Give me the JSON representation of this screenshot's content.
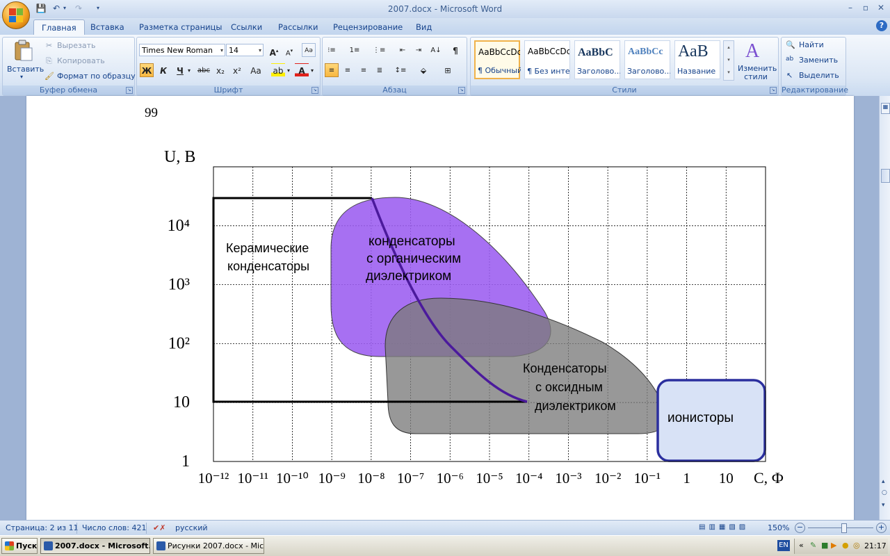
{
  "window": {
    "title": "2007.docx - Microsoft Word",
    "controls": [
      "–",
      "▫",
      "✕"
    ],
    "help": "?"
  },
  "quick_access": [
    "💾",
    "↶",
    "▾",
    "↷",
    "▾"
  ],
  "tabs": [
    {
      "label": "Главная",
      "active": true
    },
    {
      "label": "Вставка",
      "active": false
    },
    {
      "label": "Разметка страницы",
      "active": false
    },
    {
      "label": "Ссылки",
      "active": false
    },
    {
      "label": "Рассылки",
      "active": false
    },
    {
      "label": "Рецензирование",
      "active": false
    },
    {
      "label": "Вид",
      "active": false
    }
  ],
  "clipboard": {
    "paste": "Вставить",
    "cut": "Вырезать",
    "copy": "Копировать",
    "format_painter": "Формат по образцу",
    "label": "Буфер обмена"
  },
  "font": {
    "name": "Times New Roman",
    "size": "14",
    "label": "Шрифт",
    "buttons": [
      "Ж",
      "К",
      "Ч",
      "abc",
      "x₂",
      "x²",
      "Aa"
    ]
  },
  "paragraph": {
    "label": "Абзац"
  },
  "styles": {
    "label": "Стили",
    "items": [
      {
        "sample": "AaBbCcDc",
        "name": "¶ Обычный",
        "selected": true
      },
      {
        "sample": "AaBbCcDc",
        "name": "¶ Без инте...",
        "selected": false
      },
      {
        "sample": "AaBbC",
        "name": "Заголово...",
        "selected": false
      },
      {
        "sample": "AaBbCc",
        "name": "Заголово...",
        "selected": false
      },
      {
        "sample": "АаВ",
        "name": "Название",
        "selected": false
      }
    ],
    "change": "Изменить стили"
  },
  "editing": {
    "label": "Редактирование",
    "find": "Найти",
    "replace": "Заменить",
    "select": "Выделить"
  },
  "document": {
    "page_number": "99",
    "chart_data": {
      "type": "area",
      "title": "",
      "xlabel": "С, Ф",
      "ylabel": "U, В",
      "x_scale": "log",
      "y_scale": "log",
      "xlim": [
        1e-12,
        100
      ],
      "ylim": [
        1,
        100000
      ],
      "x_tick_labels": [
        "10⁻¹²",
        "10⁻¹¹",
        "10⁻¹⁰",
        "10⁻⁹",
        "10⁻⁸",
        "10⁻⁷",
        "10⁻⁶",
        "10⁻⁵",
        "10⁻⁴",
        "10⁻³",
        "10⁻²",
        "10⁻¹",
        "1",
        "10"
      ],
      "y_tick_labels": [
        "1",
        "10",
        "10²",
        "10³",
        "10⁴"
      ],
      "grid": true,
      "regions": [
        {
          "label": "Керамические конденсаторы",
          "color": "#000000",
          "style": "outline",
          "bounds": {
            "x": [
              1e-12,
              1e-08
            ],
            "y": [
              10,
              20000
            ]
          }
        },
        {
          "label": "конденсаторы с органическим диэлектриком",
          "color": "#9b5cf0",
          "style": "filled",
          "bounds": {
            "x": [
              1e-09,
              0.0001
            ],
            "y": [
              120,
              20000
            ]
          }
        },
        {
          "label": "Конденсаторы с оксидным диэлектриком",
          "color": "#808080",
          "style": "filled",
          "bounds": {
            "x": [
              3e-08,
              3
            ],
            "y": [
              5,
              1000
            ]
          }
        },
        {
          "label": "ионисторы",
          "color": "#2b2f9e",
          "style": "outline-filled",
          "bounds": {
            "x": [
              0.1,
              30
            ],
            "y": [
              1,
              15
            ]
          }
        }
      ],
      "curve": {
        "color": "#4b1a9c",
        "points": [
          {
            "x": 1e-08,
            "y": 20000
          },
          {
            "x": 1e-07,
            "y": 2000
          },
          {
            "x": 1e-06,
            "y": 200
          },
          {
            "x": 1e-05,
            "y": 30
          },
          {
            "x": 0.0001,
            "y": 10
          }
        ]
      }
    },
    "labels": {
      "ceramic": [
        "Керамические",
        "конденсаторы"
      ],
      "organic": [
        "конденсаторы",
        "с органическим",
        "диэлектриком"
      ],
      "oxide": [
        "Конденсаторы",
        "с оксидным",
        "диэлектриком"
      ],
      "ionistor": "ионисторы"
    }
  },
  "statusbar": {
    "page": "Страница: 2 из 11",
    "words": "Число слов: 421",
    "language": "русский",
    "zoom": "150%"
  },
  "taskbar": {
    "start": "Пуск",
    "tasks": [
      {
        "label": "2007.docx - Microsoft...",
        "active": true
      },
      {
        "label": "Рисунки 2007.docx - Mic...",
        "active": false
      }
    ],
    "lang": "EN",
    "time": "21:17"
  }
}
